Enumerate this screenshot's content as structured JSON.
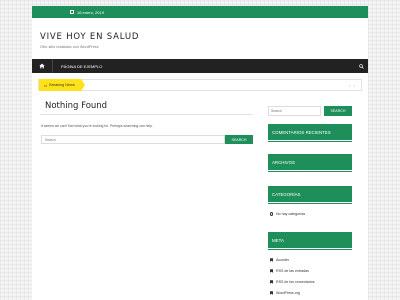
{
  "topbar": {
    "date": "16 enero, 2019"
  },
  "site": {
    "title": "VIVE HOY EN SALUD",
    "description": "Otro sitio realizado con WordPress"
  },
  "nav": {
    "items": [
      {
        "label": "PÁGINA DE EJEMPLO"
      }
    ]
  },
  "ticker": {
    "label": "Breaking News",
    "arrows": "‹ ›"
  },
  "main": {
    "title": "Nothing Found",
    "message": "It seems we can't find what you're looking for. Perhaps searching can help.",
    "search": {
      "placeholder": "Search",
      "button": "SEARCH"
    }
  },
  "sidebar": {
    "search": {
      "placeholder": "Search",
      "button": "SEARCH"
    },
    "widgets": {
      "recent_comments": "COMENTARIOS RECIENTES",
      "archives": "ARCHIVOS",
      "categories": "CATEGORÍAS",
      "categories_empty": "No hay categorías",
      "meta": "META",
      "meta_links": [
        "Acceder",
        "RSS de las entradas",
        "RSS de los comentarios",
        "WordPress.org"
      ]
    }
  },
  "colors": {
    "accent": "#1e8f5a",
    "navbar": "#222222",
    "ticker": "#ffe21a"
  }
}
